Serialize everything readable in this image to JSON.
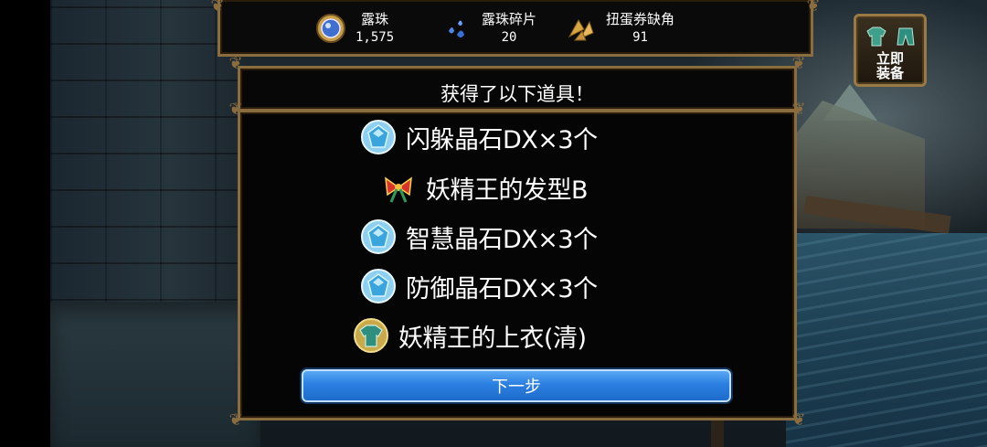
{
  "currencies": [
    {
      "label": "露珠",
      "value": "1,575",
      "icon": "dew-orb-icon"
    },
    {
      "label": "露珠碎片",
      "value": "20",
      "icon": "dew-shard-icon"
    },
    {
      "label": "扭蛋券缺角",
      "value": "91",
      "icon": "gacha-ticket-fragment-icon"
    }
  ],
  "equip_button": {
    "line1": "立即",
    "line2": "装备"
  },
  "dialog": {
    "title": "获得了以下道具！",
    "items": [
      {
        "label": "闪躲晶石DX×3个",
        "icon": "crystal-icon"
      },
      {
        "label": "妖精王的发型B",
        "icon": "ribbon-bow-icon"
      },
      {
        "label": "智慧晶石DX×3个",
        "icon": "crystal-icon"
      },
      {
        "label": "防御晶石DX×3个",
        "icon": "crystal-icon"
      },
      {
        "label": "妖精王的上衣(清)",
        "icon": "armor-top-icon"
      }
    ],
    "next_label": "下一步"
  },
  "colors": {
    "accent_blue": "#2a7fe0",
    "frame_gold": "#8a6d3e",
    "panel_bg": "#050505"
  }
}
